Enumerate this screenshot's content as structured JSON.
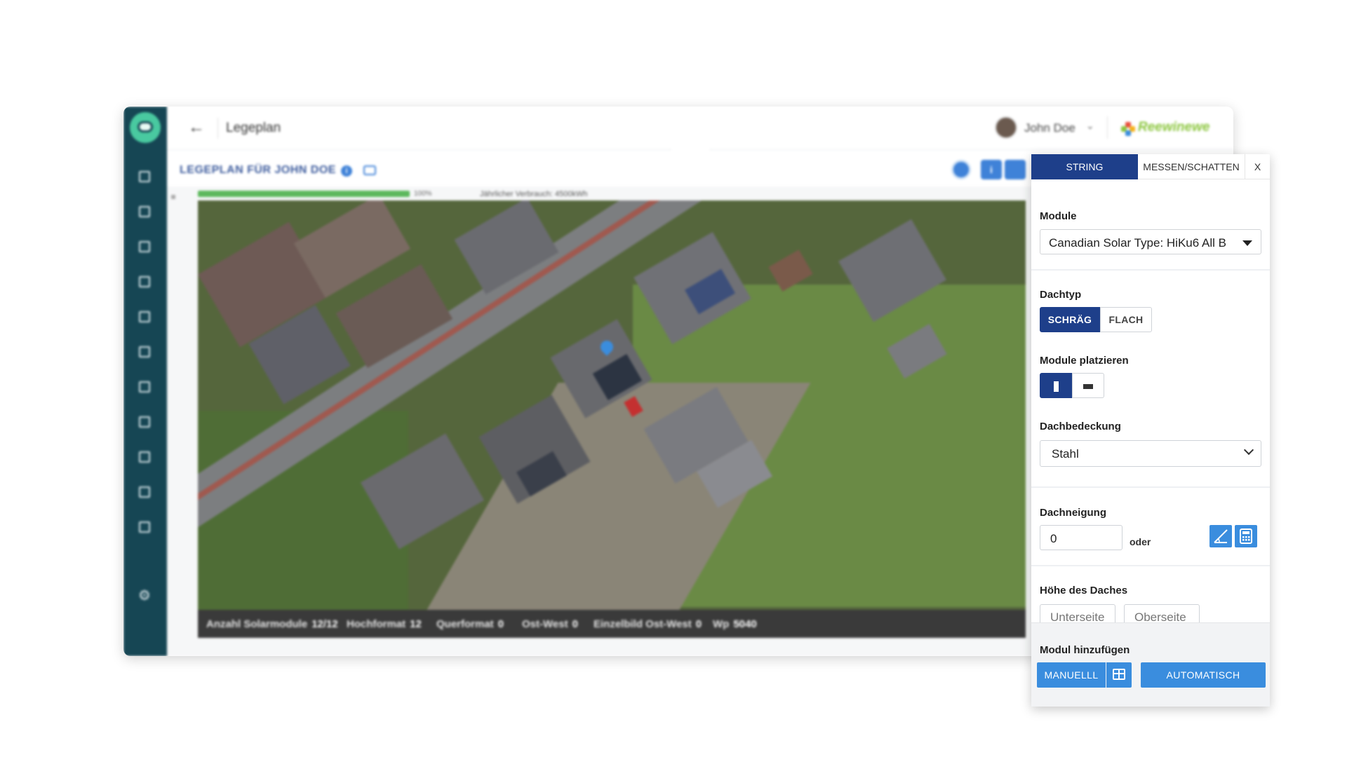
{
  "header": {
    "page_title": "Legeplan",
    "user_name": "John Doe",
    "brand": "Reewinewe"
  },
  "subheader": {
    "plan_title": "LEGEPLAN FÜR JOHN DOE"
  },
  "canvas": {
    "progress_percent_text": "100%",
    "progress_fraction": 1.0,
    "consumption_text": "Jährlicher Verbrauch: 4500kWh"
  },
  "stats": [
    {
      "label": "Anzahl Solarmodule",
      "value": "12/12"
    },
    {
      "label": "Hochformat",
      "value": "12"
    },
    {
      "label": "Querformat",
      "value": "0"
    },
    {
      "label": "Ost-West",
      "value": "0"
    },
    {
      "label": "Einzelbild Ost-West",
      "value": "0"
    },
    {
      "label": "Wp",
      "value": "5040"
    }
  ],
  "panel": {
    "tabs": {
      "string": "STRING",
      "measure": "MESSEN/SCHATTEN",
      "close": "X"
    },
    "module": {
      "label": "Module",
      "selected": "Canadian Solar Type: HiKu6 All B"
    },
    "roof_type": {
      "label": "Dachtyp",
      "options": [
        "SCHRÄG",
        "FLACH"
      ],
      "selected": "SCHRÄG"
    },
    "place_modules": {
      "label": "Module platzieren",
      "selected": "portrait"
    },
    "roof_covering": {
      "label": "Dachbedeckung",
      "selected": "Stahl"
    },
    "roof_inclination": {
      "label": "Dachneigung",
      "value": "0",
      "or_text": "oder"
    },
    "roof_height": {
      "label": "Höhe des Daches",
      "lower_placeholder": "Unterseite",
      "upper_placeholder": "Oberseite"
    },
    "add_module": {
      "label": "Modul hinzufügen",
      "manual": "MANUELLL",
      "automatic": "AUTOMATISCH"
    }
  },
  "colors": {
    "sidebar": "#164654",
    "primary": "#1e3f8a",
    "button": "#3a8dde",
    "brand_green": "#8cc63f"
  }
}
